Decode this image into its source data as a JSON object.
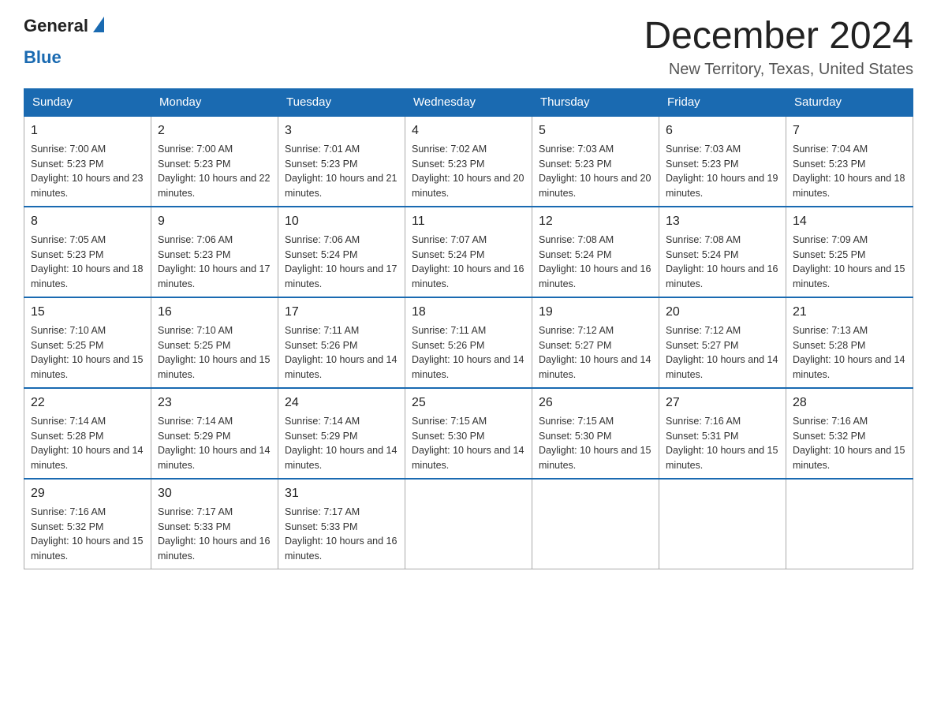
{
  "logo": {
    "general": "General",
    "blue": "Blue"
  },
  "header": {
    "title": "December 2024",
    "subtitle": "New Territory, Texas, United States"
  },
  "days_of_week": [
    "Sunday",
    "Monday",
    "Tuesday",
    "Wednesday",
    "Thursday",
    "Friday",
    "Saturday"
  ],
  "weeks": [
    [
      {
        "day": "1",
        "sunrise": "7:00 AM",
        "sunset": "5:23 PM",
        "daylight": "10 hours and 23 minutes."
      },
      {
        "day": "2",
        "sunrise": "7:00 AM",
        "sunset": "5:23 PM",
        "daylight": "10 hours and 22 minutes."
      },
      {
        "day": "3",
        "sunrise": "7:01 AM",
        "sunset": "5:23 PM",
        "daylight": "10 hours and 21 minutes."
      },
      {
        "day": "4",
        "sunrise": "7:02 AM",
        "sunset": "5:23 PM",
        "daylight": "10 hours and 20 minutes."
      },
      {
        "day": "5",
        "sunrise": "7:03 AM",
        "sunset": "5:23 PM",
        "daylight": "10 hours and 20 minutes."
      },
      {
        "day": "6",
        "sunrise": "7:03 AM",
        "sunset": "5:23 PM",
        "daylight": "10 hours and 19 minutes."
      },
      {
        "day": "7",
        "sunrise": "7:04 AM",
        "sunset": "5:23 PM",
        "daylight": "10 hours and 18 minutes."
      }
    ],
    [
      {
        "day": "8",
        "sunrise": "7:05 AM",
        "sunset": "5:23 PM",
        "daylight": "10 hours and 18 minutes."
      },
      {
        "day": "9",
        "sunrise": "7:06 AM",
        "sunset": "5:23 PM",
        "daylight": "10 hours and 17 minutes."
      },
      {
        "day": "10",
        "sunrise": "7:06 AM",
        "sunset": "5:24 PM",
        "daylight": "10 hours and 17 minutes."
      },
      {
        "day": "11",
        "sunrise": "7:07 AM",
        "sunset": "5:24 PM",
        "daylight": "10 hours and 16 minutes."
      },
      {
        "day": "12",
        "sunrise": "7:08 AM",
        "sunset": "5:24 PM",
        "daylight": "10 hours and 16 minutes."
      },
      {
        "day": "13",
        "sunrise": "7:08 AM",
        "sunset": "5:24 PM",
        "daylight": "10 hours and 16 minutes."
      },
      {
        "day": "14",
        "sunrise": "7:09 AM",
        "sunset": "5:25 PM",
        "daylight": "10 hours and 15 minutes."
      }
    ],
    [
      {
        "day": "15",
        "sunrise": "7:10 AM",
        "sunset": "5:25 PM",
        "daylight": "10 hours and 15 minutes."
      },
      {
        "day": "16",
        "sunrise": "7:10 AM",
        "sunset": "5:25 PM",
        "daylight": "10 hours and 15 minutes."
      },
      {
        "day": "17",
        "sunrise": "7:11 AM",
        "sunset": "5:26 PM",
        "daylight": "10 hours and 14 minutes."
      },
      {
        "day": "18",
        "sunrise": "7:11 AM",
        "sunset": "5:26 PM",
        "daylight": "10 hours and 14 minutes."
      },
      {
        "day": "19",
        "sunrise": "7:12 AM",
        "sunset": "5:27 PM",
        "daylight": "10 hours and 14 minutes."
      },
      {
        "day": "20",
        "sunrise": "7:12 AM",
        "sunset": "5:27 PM",
        "daylight": "10 hours and 14 minutes."
      },
      {
        "day": "21",
        "sunrise": "7:13 AM",
        "sunset": "5:28 PM",
        "daylight": "10 hours and 14 minutes."
      }
    ],
    [
      {
        "day": "22",
        "sunrise": "7:14 AM",
        "sunset": "5:28 PM",
        "daylight": "10 hours and 14 minutes."
      },
      {
        "day": "23",
        "sunrise": "7:14 AM",
        "sunset": "5:29 PM",
        "daylight": "10 hours and 14 minutes."
      },
      {
        "day": "24",
        "sunrise": "7:14 AM",
        "sunset": "5:29 PM",
        "daylight": "10 hours and 14 minutes."
      },
      {
        "day": "25",
        "sunrise": "7:15 AM",
        "sunset": "5:30 PM",
        "daylight": "10 hours and 14 minutes."
      },
      {
        "day": "26",
        "sunrise": "7:15 AM",
        "sunset": "5:30 PM",
        "daylight": "10 hours and 15 minutes."
      },
      {
        "day": "27",
        "sunrise": "7:16 AM",
        "sunset": "5:31 PM",
        "daylight": "10 hours and 15 minutes."
      },
      {
        "day": "28",
        "sunrise": "7:16 AM",
        "sunset": "5:32 PM",
        "daylight": "10 hours and 15 minutes."
      }
    ],
    [
      {
        "day": "29",
        "sunrise": "7:16 AM",
        "sunset": "5:32 PM",
        "daylight": "10 hours and 15 minutes."
      },
      {
        "day": "30",
        "sunrise": "7:17 AM",
        "sunset": "5:33 PM",
        "daylight": "10 hours and 16 minutes."
      },
      {
        "day": "31",
        "sunrise": "7:17 AM",
        "sunset": "5:33 PM",
        "daylight": "10 hours and 16 minutes."
      },
      null,
      null,
      null,
      null
    ]
  ],
  "labels": {
    "sunrise_prefix": "Sunrise: ",
    "sunset_prefix": "Sunset: ",
    "daylight_prefix": "Daylight: "
  }
}
